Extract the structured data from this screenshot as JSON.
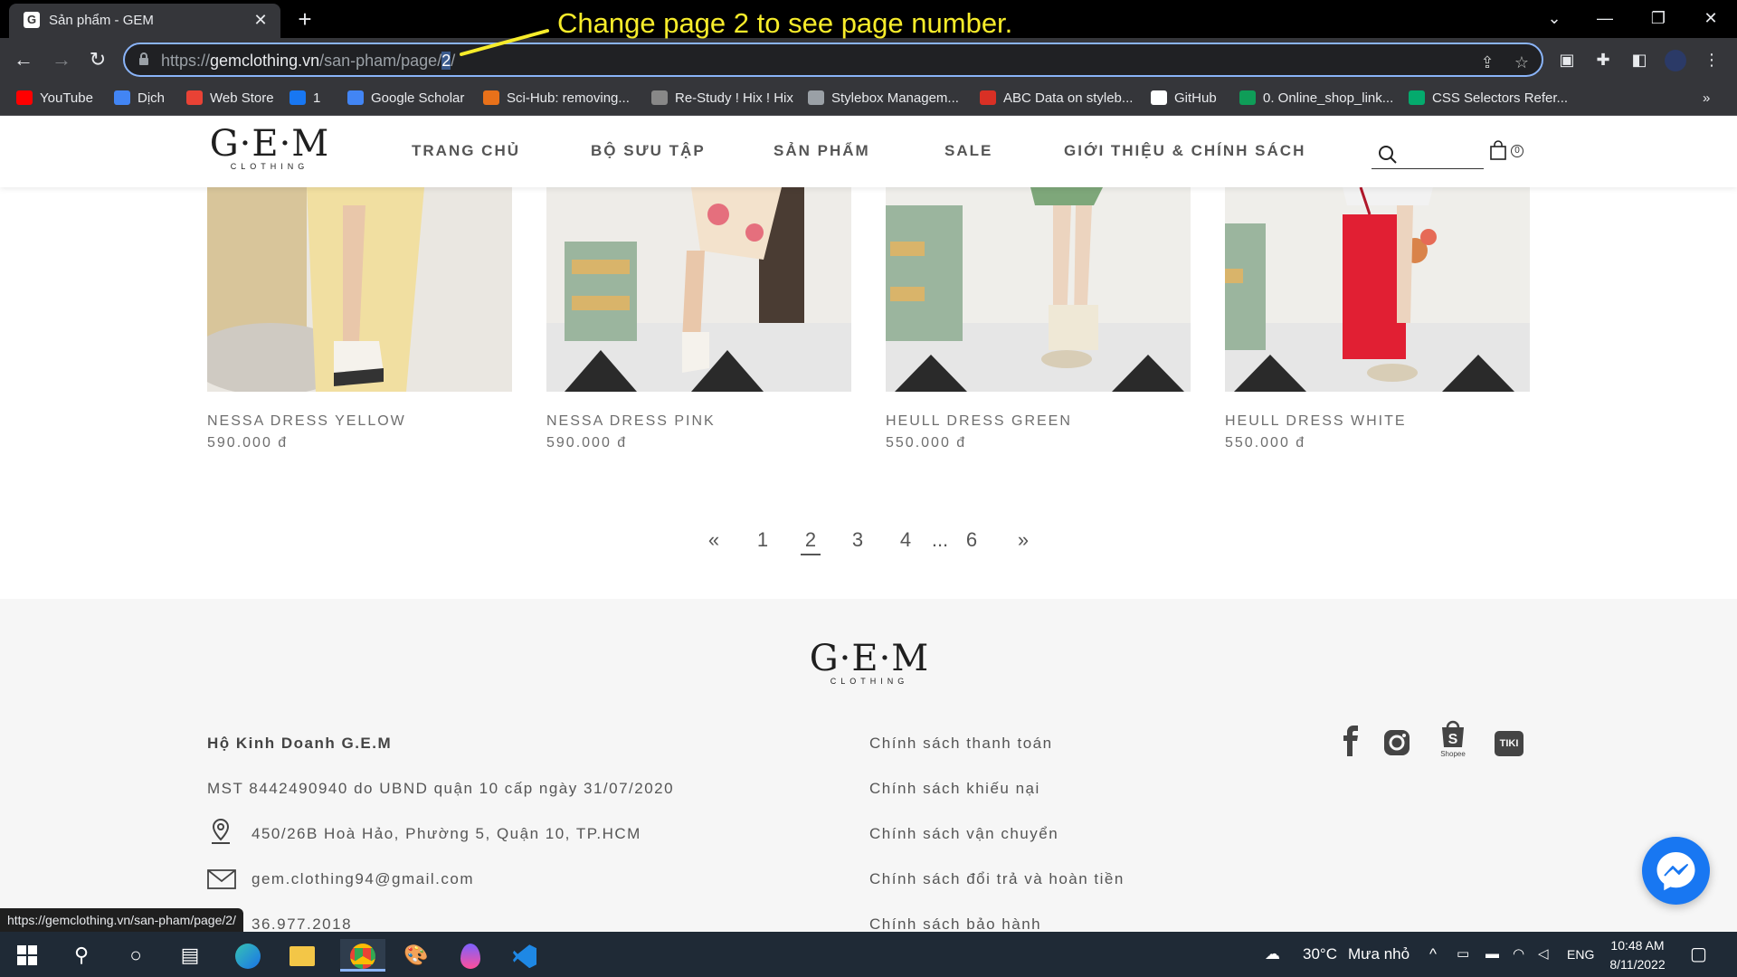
{
  "browser": {
    "tab_title": "Sản phẩm - GEM",
    "url_prefix": "https://",
    "url_host": "gemclothing.vn",
    "url_path": "/san-pham/page/",
    "url_selected": "2",
    "url_tail": "/",
    "annotation": "Change page 2 to see page number.",
    "annotation_color": "#f7ec2a",
    "status_url": "https://gemclothing.vn/san-pham/page/2/",
    "bookmarks": [
      {
        "label": "YouTube",
        "icon": "youtube-icon",
        "color": "#ff0000"
      },
      {
        "label": "Dịch",
        "icon": "translate-icon",
        "color": "#4285f4"
      },
      {
        "label": "Web Store",
        "icon": "webstore-icon",
        "color": "#e94235"
      },
      {
        "label": "1",
        "icon": "facebook-icon",
        "color": "#1877f2"
      },
      {
        "label": "Google Scholar",
        "icon": "scholar-icon",
        "color": "#4285f4"
      },
      {
        "label": "Sci-Hub: removing...",
        "icon": "scihub-icon",
        "color": "#e8711a"
      },
      {
        "label": "Re-Study ! Hix ! Hix",
        "icon": "restudy-icon",
        "color": "#888888"
      },
      {
        "label": "Stylebox Managem...",
        "icon": "gear-icon",
        "color": "#9aa0a6"
      },
      {
        "label": "ABC Data on styleb...",
        "icon": "abc-icon",
        "color": "#d93025"
      },
      {
        "label": "GitHub",
        "icon": "github-icon",
        "color": "#ffffff"
      },
      {
        "label": "0. Online_shop_link...",
        "icon": "sheets-icon",
        "color": "#0f9d58"
      },
      {
        "label": "CSS Selectors Refer...",
        "icon": "w3-icon",
        "color": "#04aa6d"
      }
    ]
  },
  "site": {
    "logo_main": "G·E·M",
    "logo_sub": "CLOTHING",
    "nav": [
      "TRANG CHỦ",
      "BỘ SƯU TẬP",
      "SẢN PHẨM",
      "SALE",
      "GIỚI THIỆU & CHÍNH SÁCH"
    ],
    "cart_count": "0"
  },
  "products": [
    {
      "name": "NESSA DRESS YELLOW",
      "price": "590.000 đ"
    },
    {
      "name": "NESSA DRESS PINK",
      "price": "590.000 đ"
    },
    {
      "name": "HEULL DRESS GREEN",
      "price": "550.000 đ"
    },
    {
      "name": "HEULL DRESS WHITE",
      "price": "550.000 đ"
    }
  ],
  "pagination": {
    "prev": "«",
    "pages": [
      "1",
      "2",
      "3",
      "4"
    ],
    "ellipsis": "...",
    "last": "6",
    "next": "»",
    "current": "2"
  },
  "footer": {
    "logo_main": "G·E·M",
    "logo_sub": "CLOTHING",
    "company": "Hộ Kinh Doanh G.E.M",
    "tax": "MST 8442490940 do UBND quận 10 cấp ngày 31/07/2020",
    "address": "450/26B Hoà Hảo, Phường 5, Quận 10, TP.HCM",
    "email": "gem.clothing94@gmail.com",
    "phone_partial": "36.977.2018",
    "policies": [
      "Chính sách thanh toán",
      "Chính sách khiếu nại",
      "Chính sách vận chuyển",
      "Chính sách đổi trả và hoàn tiền",
      "Chính sách bảo hành"
    ],
    "shopee_label": "Shopee",
    "tiki_label": "TIKI"
  },
  "taskbar": {
    "weather_temp": "30°C",
    "weather_desc": "Mưa nhỏ",
    "lang": "ENG",
    "time": "10:48 AM",
    "date": "8/11/2022"
  }
}
